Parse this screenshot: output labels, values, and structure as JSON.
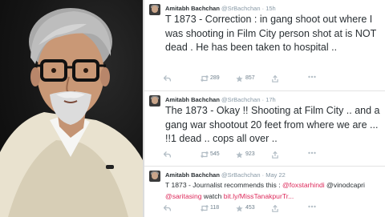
{
  "photo": {
    "subject": "portrait"
  },
  "tweets": [
    {
      "name": "Amitabh Bachchan",
      "handle": "@SrBachchan",
      "separator": "·",
      "time": "15h",
      "text": "T 1873 - Correction : in  gang shoot out where I was shooting in Film City person shot at is NOT dead . He has been taken to hospital  ..",
      "retweets": "289",
      "favorites": "857"
    },
    {
      "name": "Amitabh Bachchan",
      "handle": "@SrBachchan",
      "separator": "·",
      "time": "17h",
      "text": "The 1873 - Okay !! Shooting at Film City .. and a gang war shootout 20 feet from where we are ... !!1 dead .. cops all over ..",
      "retweets": "545",
      "favorites": "923"
    },
    {
      "name": "Amitabh Bachchan",
      "handle": "@SrBachchan",
      "separator": "·",
      "time": "May 22",
      "text_prefix": "T 1873 - Journalist recommends this : ",
      "mention_1": "@foxstarhindi",
      "mention_2": " @vinodcapri",
      "mention_3": "@saritasing",
      "text_mid": " watch ",
      "link": "bit.ly/MissTanakpurTr...",
      "retweets": "118",
      "favorites": "453"
    }
  ],
  "icons": {
    "reply": "reply-icon",
    "retweet": "retweet-icon",
    "favorite": "star-icon",
    "share": "share-icon",
    "more": "more-icon"
  },
  "colors": {
    "link": "#dd2a5b",
    "meta": "#8899a6",
    "text": "#292f33"
  }
}
